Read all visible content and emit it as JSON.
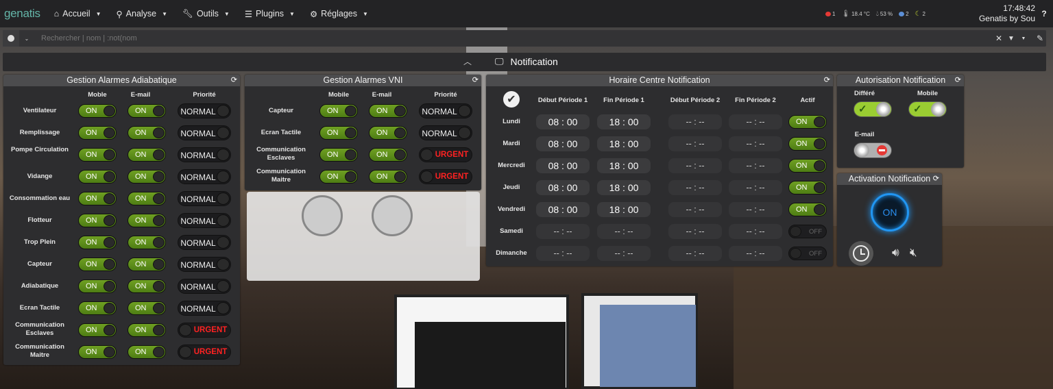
{
  "navbar": {
    "brand": "genatis",
    "items": [
      {
        "icon": "home-icon",
        "label": "Accueil"
      },
      {
        "icon": "analyse-icon",
        "label": "Analyse"
      },
      {
        "icon": "wrench-icon",
        "label": "Outils"
      },
      {
        "icon": "list-icon",
        "label": "Plugins"
      },
      {
        "icon": "gear-icon",
        "label": "Réglages"
      }
    ],
    "status": [
      {
        "icon": "alert-icon",
        "value": "1",
        "color": "#e53935"
      },
      {
        "icon": "thermometer-icon",
        "value": "18.4 °C",
        "color": "#cccccc"
      },
      {
        "icon": "humidity-icon",
        "value": "53 %",
        "color": "#cccccc"
      },
      {
        "icon": "cloud-icon",
        "value": "2",
        "color": "#5c8fd6"
      },
      {
        "icon": "moon-icon",
        "value": "2",
        "color": "#c0d030"
      }
    ],
    "time": "17:48:42",
    "user": "Genatis by Sou",
    "help": "?"
  },
  "search": {
    "placeholder": "Rechercher | nom | :not(nom"
  },
  "object": {
    "title": "Notification"
  },
  "adiabatique": {
    "title": "Gestion Alarmes Adiabatique",
    "cols": [
      "Moble",
      "E-mail",
      "Priorité"
    ],
    "rows": [
      {
        "label": "Ventilateur",
        "moble": "ON",
        "email": "ON",
        "priority": "NORMAL"
      },
      {
        "label": "Remplissage",
        "moble": "ON",
        "email": "ON",
        "priority": "NORMAL"
      },
      {
        "label": "Pompe Circulation",
        "moble": "ON",
        "email": "ON",
        "priority": "NORMAL"
      },
      {
        "label": "Vidange",
        "moble": "ON",
        "email": "ON",
        "priority": "NORMAL"
      },
      {
        "label": "Consommation eau",
        "moble": "ON",
        "email": "ON",
        "priority": "NORMAL"
      },
      {
        "label": "Flotteur",
        "moble": "ON",
        "email": "ON",
        "priority": "NORMAL"
      },
      {
        "label": "Trop Plein",
        "moble": "ON",
        "email": "ON",
        "priority": "NORMAL"
      },
      {
        "label": "Capteur",
        "moble": "ON",
        "email": "ON",
        "priority": "NORMAL"
      },
      {
        "label": "Adiabatique",
        "moble": "ON",
        "email": "ON",
        "priority": "NORMAL"
      },
      {
        "label": "Ecran Tactile",
        "moble": "ON",
        "email": "ON",
        "priority": "NORMAL"
      },
      {
        "label": "Communication Esclaves",
        "moble": "ON",
        "email": "ON",
        "priority": "URGENT"
      },
      {
        "label": "Communication Maitre",
        "moble": "ON",
        "email": "ON",
        "priority": "URGENT"
      }
    ]
  },
  "vni": {
    "title": "Gestion Alarmes VNI",
    "cols": [
      "Mobile",
      "E-mail",
      "Priorité"
    ],
    "rows": [
      {
        "label": "Capteur",
        "moble": "ON",
        "email": "ON",
        "priority": "NORMAL"
      },
      {
        "label": "Ecran Tactile",
        "moble": "ON",
        "email": "ON",
        "priority": "NORMAL"
      },
      {
        "label": "Communication Esclaves",
        "moble": "ON",
        "email": "ON",
        "priority": "URGENT"
      },
      {
        "label": "Communication Maitre",
        "moble": "ON",
        "email": "ON",
        "priority": "URGENT"
      }
    ]
  },
  "horaire": {
    "title": "Horaire Centre Notification",
    "cols": [
      "Début Période 1",
      "Fin Période 1",
      "Début Période 2",
      "Fin Période 2",
      "Actif"
    ],
    "rows": [
      {
        "day": "Lundi",
        "d1": "08 : 00",
        "f1": "18 : 00",
        "d2": "-- : --",
        "f2": "-- : --",
        "active": "ON"
      },
      {
        "day": "Mardi",
        "d1": "08 : 00",
        "f1": "18 : 00",
        "d2": "-- : --",
        "f2": "-- : --",
        "active": "ON"
      },
      {
        "day": "Mercredi",
        "d1": "08 : 00",
        "f1": "18 : 00",
        "d2": "-- : --",
        "f2": "-- : --",
        "active": "ON"
      },
      {
        "day": "Jeudi",
        "d1": "08 : 00",
        "f1": "18 : 00",
        "d2": "-- : --",
        "f2": "-- : --",
        "active": "ON"
      },
      {
        "day": "Vendredi",
        "d1": "08 : 00",
        "f1": "18 : 00",
        "d2": "-- : --",
        "f2": "-- : --",
        "active": "ON"
      },
      {
        "day": "Samedi",
        "d1": "-- : --",
        "f1": "-- : --",
        "d2": "-- : --",
        "f2": "-- : --",
        "active": "OFF"
      },
      {
        "day": "Dimanche",
        "d1": "-- : --",
        "f1": "-- : --",
        "d2": "-- : --",
        "f2": "-- : --",
        "active": "OFF"
      }
    ]
  },
  "autorisation": {
    "title": "Autorisation Notification",
    "differe": "Différé",
    "mobile": "Mobile",
    "email": "E-mail"
  },
  "activation": {
    "title": "Activation Notification",
    "state": "ON"
  }
}
